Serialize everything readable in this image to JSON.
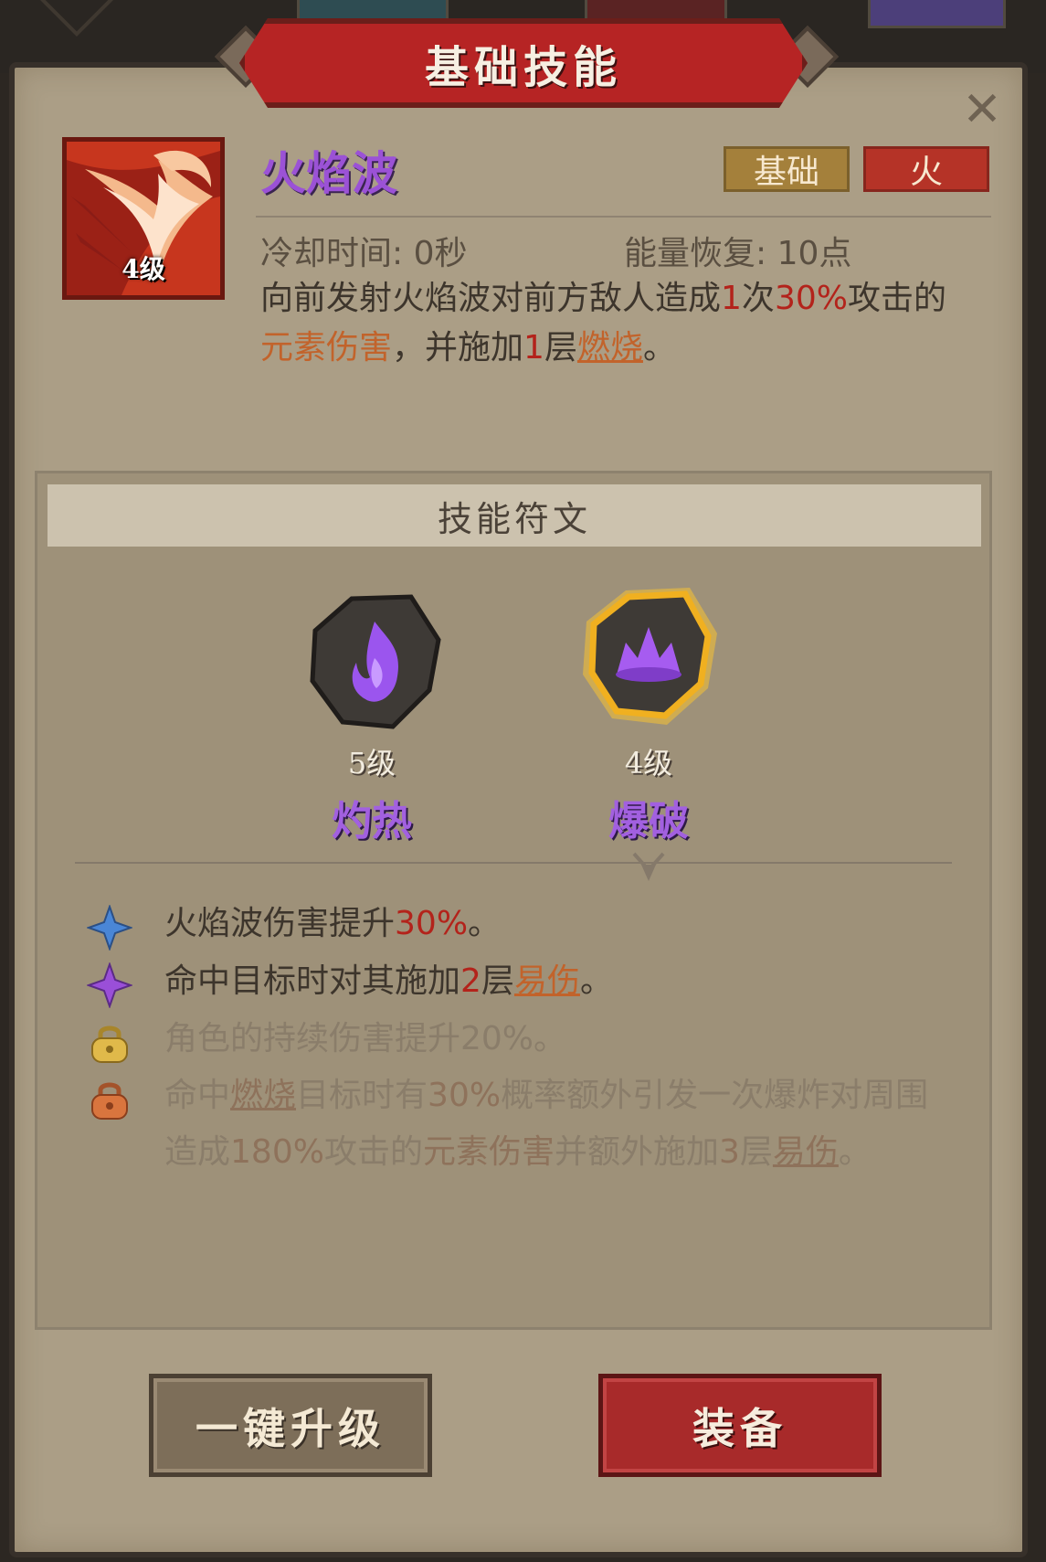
{
  "window": {
    "title": "基础技能"
  },
  "skill": {
    "name": "火焰波",
    "level": "4级",
    "tags": [
      "基础",
      "火"
    ],
    "cooldown": "冷却时间: 0秒",
    "energy": "能量恢复: 10点",
    "desc": {
      "p1": "向前发射火焰波对前方敌人造成",
      "n1": "1",
      "p2": "次",
      "n2": "30%",
      "p3": "攻击的",
      "kw1": "元素伤害",
      "p4": "，并施加",
      "n3": "1",
      "p5": "层",
      "kw2": "燃烧",
      "p6": "。"
    }
  },
  "runes": {
    "header": "技能符文",
    "items": [
      {
        "level": "5级",
        "name": "灼热",
        "icon": "flame-swirl-icon"
      },
      {
        "level": "4级",
        "name": "爆破",
        "icon": "burst-icon",
        "selected": true
      }
    ]
  },
  "effects": [
    {
      "icon": "blue-star-icon",
      "t1": "火焰波伤害提升",
      "v1": "30%",
      "t2": "。"
    },
    {
      "icon": "purple-star-icon",
      "t1": "命中目标时对其施加",
      "v1": "2",
      "t2": "层",
      "kw": "易伤",
      "t3": "。"
    },
    {
      "icon": "gold-lock-icon",
      "t1": "角色的持续伤害提升20%。"
    },
    {
      "icon": "orange-lock-icon",
      "t1": "命中",
      "kw1": "燃烧",
      "t2": "目标时有",
      "v1": "30%",
      "t3": "概率额外引发一次爆炸对周围造成",
      "v2": "180%",
      "t4": "攻击的",
      "kw2": "元素伤害",
      "t5": "并额外施加",
      "v3": "3",
      "t6": "层",
      "kw3": "易伤",
      "t7": "。"
    }
  ],
  "buttons": {
    "upgrade": "一键升级",
    "equip": "装备"
  },
  "colors": {
    "accent_red": "#b62424",
    "rune_purple": "#a260e0",
    "panel": "#ab9e86"
  }
}
